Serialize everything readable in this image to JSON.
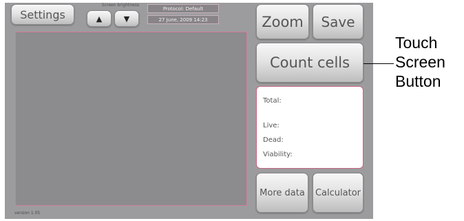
{
  "toolbar": {
    "settings_label": "Settings",
    "brightness_label": "Screen brightness",
    "brightness_up": "▲",
    "brightness_down": "▼",
    "protocol": "Protocol: Default",
    "datetime": "27 June, 2009 14:23"
  },
  "side": {
    "zoom_label": "Zoom",
    "save_label": "Save",
    "count_cells_label": "Count cells",
    "more_data_label": "More data",
    "calculator_label": "Calculator"
  },
  "results": {
    "total_label": "Total:",
    "live_label": "Live:",
    "dead_label": "Dead:",
    "viability_label": "Viability:"
  },
  "footer": {
    "version": "version 1.05"
  },
  "annotation": {
    "lines": [
      "Touch",
      "Screen",
      "Button"
    ]
  },
  "colors": {
    "panel": "#9c9c9e",
    "image_area": "#8c8b8d",
    "accent_border": "#c8647f",
    "info_box": "#888487"
  }
}
